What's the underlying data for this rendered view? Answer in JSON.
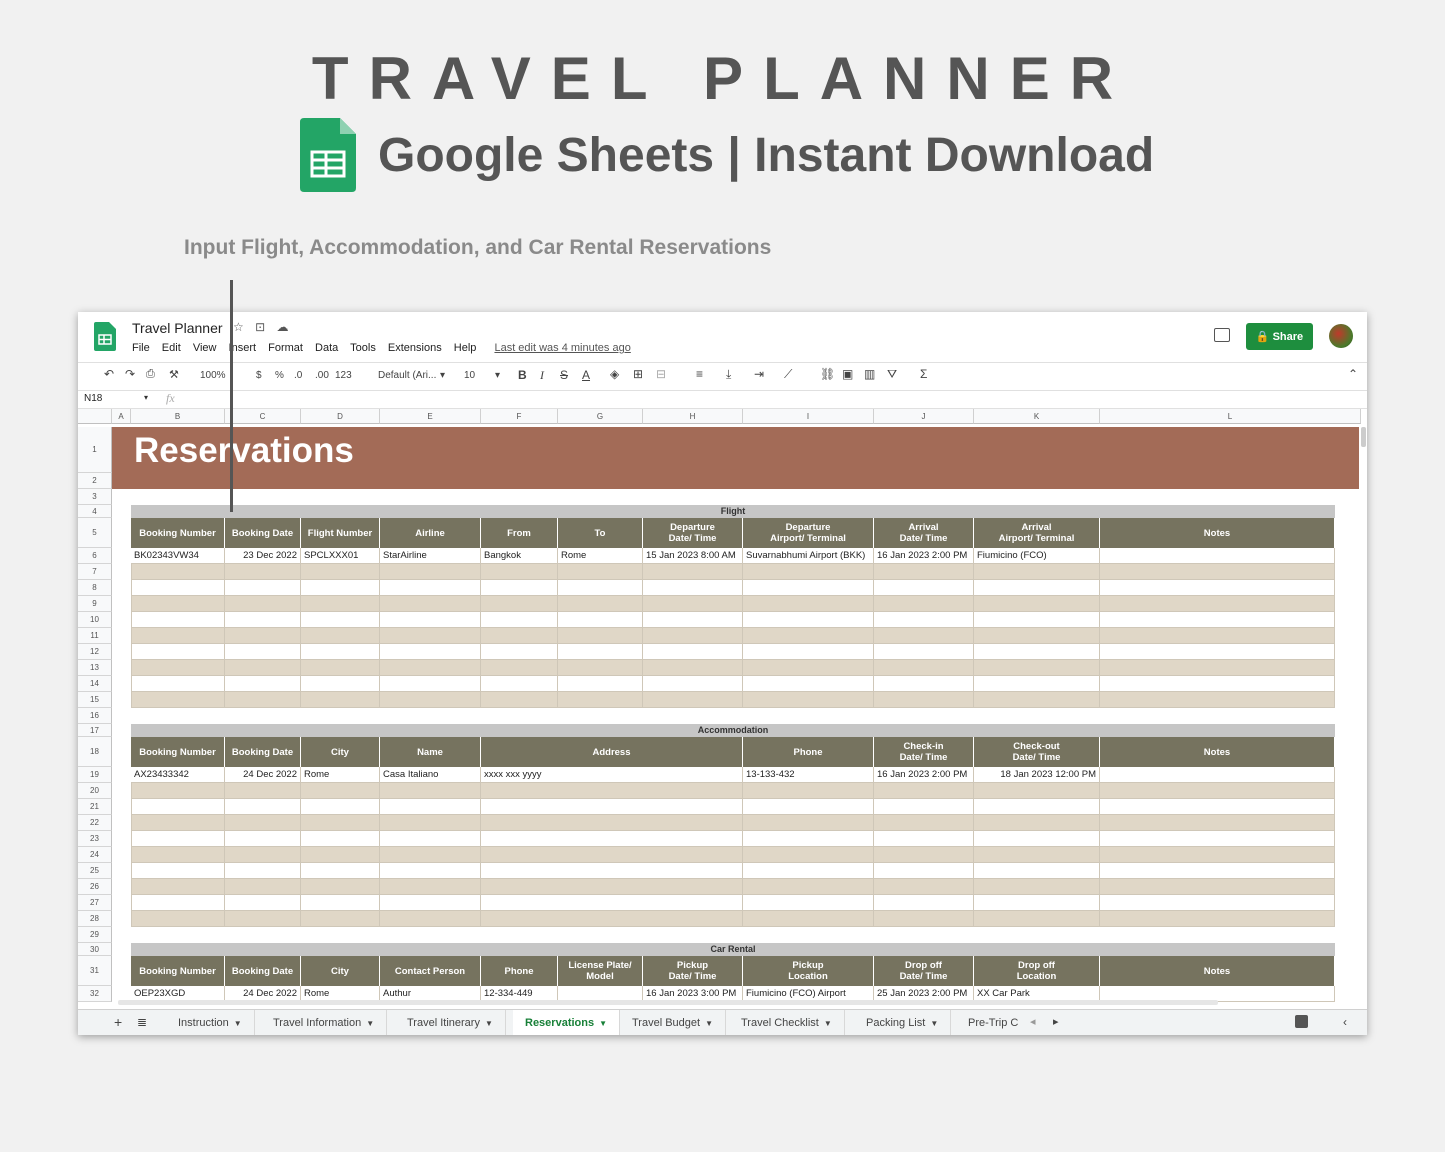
{
  "hero": {
    "title": "TRAVEL PLANNER",
    "subtitle": "Google Sheets | Instant Download",
    "caption": "Input Flight, Accommodation, and Car Rental Reservations"
  },
  "app": {
    "doc_title": "Travel Planner",
    "menus": [
      "File",
      "Edit",
      "View",
      "Insert",
      "Format",
      "Data",
      "Tools",
      "Extensions",
      "Help"
    ],
    "last_edit": "Last edit was 4 minutes ago",
    "share_label": "Share",
    "cell_ref": "N18",
    "fx": "fx",
    "accent": "#1e8e3e"
  },
  "toolbar": {
    "zoom": "100%",
    "currency": "$",
    "percent": "%",
    "dec_less": ".0",
    "dec_more": ".00",
    "number_format": "123",
    "font": "Default (Ari...",
    "size": "10",
    "bold": "B",
    "italic": "I",
    "strike": "S",
    "text_color": "A"
  },
  "columns": [
    "A",
    "B",
    "C",
    "D",
    "E",
    "F",
    "G",
    "H",
    "I",
    "J",
    "K",
    "L"
  ],
  "rows": [
    "1",
    "2",
    "3",
    "4",
    "5",
    "6",
    "7",
    "8",
    "9",
    "10",
    "11",
    "12",
    "13",
    "14",
    "15",
    "16",
    "17",
    "18",
    "19",
    "20",
    "21",
    "22",
    "23",
    "24",
    "25",
    "26",
    "27",
    "28",
    "29",
    "30",
    "31",
    "32"
  ],
  "sheet": {
    "banner": "Reservations",
    "banner_color": "#a36b57",
    "header_color": "#76735f",
    "stripe_color": "#e0d7c7"
  },
  "flight": {
    "title": "Flight",
    "headers": [
      "Booking Number",
      "Booking Date",
      "Flight Number",
      "Airline",
      "From",
      "To",
      "Departure\nDate/ Time",
      "Departure\nAirport/ Terminal",
      "Arrival\nDate/ Time",
      "Arrival\nAirport/ Terminal",
      "Notes"
    ],
    "row": [
      "BK02343VW34",
      "23 Dec 2022",
      "SPCLXXX01",
      "StarAirline",
      "Bangkok",
      "Rome",
      "15 Jan 2023 8:00 AM",
      "Suvarnabhumi Airport (BKK)",
      "16 Jan 2023 2:00 PM",
      "Fiumicino (FCO)",
      ""
    ]
  },
  "accommodation": {
    "title": "Accommodation",
    "headers": [
      "Booking Number",
      "Booking Date",
      "City",
      "Name",
      "Address",
      "Phone",
      "Check-in\nDate/ Time",
      "Check-out\nDate/ Time",
      "Notes"
    ],
    "row": [
      "AX23433342",
      "24 Dec 2022",
      "Rome",
      "Casa Italiano",
      "xxxx xxx yyyy",
      "13-133-432",
      "16 Jan 2023 2:00 PM",
      "18 Jan 2023 12:00 PM",
      ""
    ]
  },
  "car_rental": {
    "title": "Car Rental",
    "headers": [
      "Booking Number",
      "Booking Date",
      "City",
      "Contact Person",
      "Phone",
      "License Plate/\nModel",
      "Pickup\nDate/ Time",
      "Pickup\nLocation",
      "Drop off\nDate/ Time",
      "Drop off\nLocation",
      "Notes"
    ],
    "row": [
      "OEP23XGD",
      "24 Dec 2022",
      "Rome",
      "Authur",
      "12-334-449",
      "",
      "16 Jan 2023 3:00 PM",
      "Fiumicino (FCO) Airport",
      "25 Jan 2023 2:00 PM",
      "XX Car Park",
      ""
    ]
  },
  "tabs": [
    "Instruction",
    "Travel Information",
    "Travel Itinerary",
    "Reservations",
    "Travel Budget",
    "Travel Checklist",
    "Packing List",
    "Pre-Trip C"
  ],
  "active_tab": "Reservations"
}
